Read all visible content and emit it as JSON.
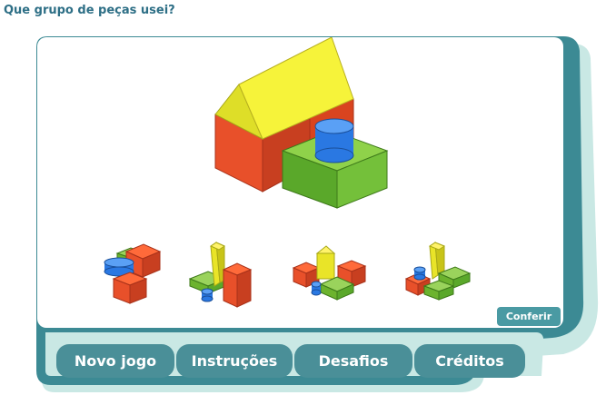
{
  "question": "Que grupo de peças usei?",
  "check_button": "Conferir",
  "nav": [
    "Novo jogo",
    "Instruções",
    "Desafios",
    "Créditos"
  ],
  "colors": {
    "accent": "#4a8f98",
    "frame": "#3c8a94",
    "frame_light": "#c9e8e4",
    "title": "#2e6f86"
  }
}
